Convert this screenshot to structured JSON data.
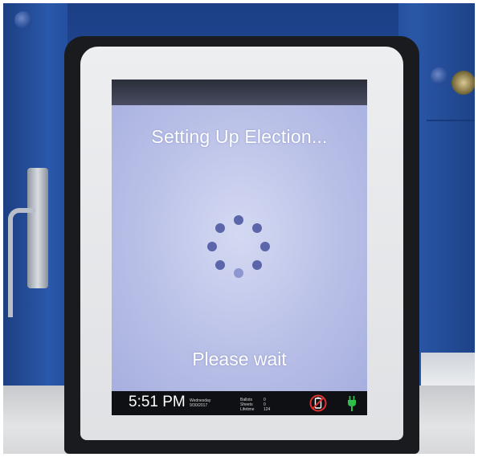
{
  "screen": {
    "title": "Setting Up Election...",
    "wait_message": "Please wait"
  },
  "status_bar": {
    "time": "5:51 PM",
    "day": "Wednesday",
    "date": "9/30/2017",
    "counters": [
      {
        "label": "Ballots",
        "value": "0"
      },
      {
        "label": "Sheets",
        "value": "0"
      },
      {
        "label": "Lifetime",
        "value": "124"
      }
    ],
    "icons": [
      "battery-alert-icon",
      "power-plug-icon"
    ]
  },
  "colors": {
    "screen_background": "#c7cdee",
    "spinner": "#5b66aa",
    "alert_red": "#e03030",
    "power_green": "#2fbf4a"
  }
}
